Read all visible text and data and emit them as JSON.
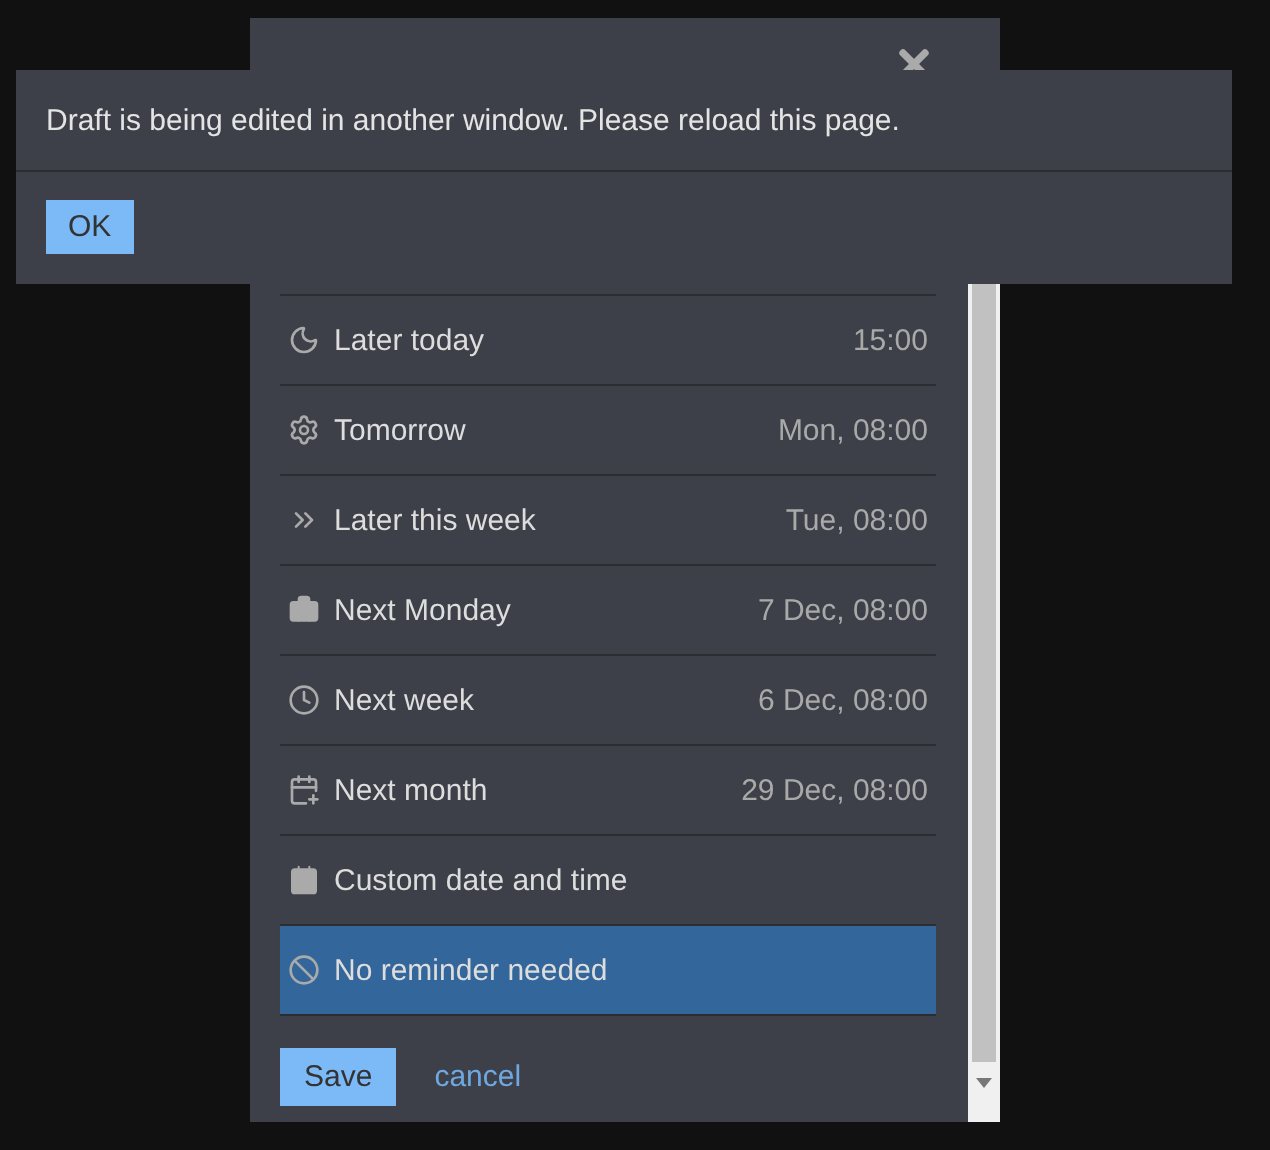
{
  "dialog": {
    "options": [
      {
        "label": "Later today",
        "time": "15:00",
        "selected": false
      },
      {
        "label": "Tomorrow",
        "time": "Mon, 08:00",
        "selected": false
      },
      {
        "label": "Later this week",
        "time": "Tue, 08:00",
        "selected": false
      },
      {
        "label": "Next Monday",
        "time": "7 Dec, 08:00",
        "selected": false
      },
      {
        "label": "Next week",
        "time": "6 Dec, 08:00",
        "selected": false
      },
      {
        "label": "Next month",
        "time": "29 Dec, 08:00",
        "selected": false
      },
      {
        "label": "Custom date and time",
        "selected": false
      },
      {
        "label": "No reminder needed",
        "selected": true
      }
    ],
    "save": "Save",
    "cancel": "cancel"
  },
  "alert": {
    "message": "Draft is being edited in another window. Please reload this page.",
    "ok": "OK"
  }
}
